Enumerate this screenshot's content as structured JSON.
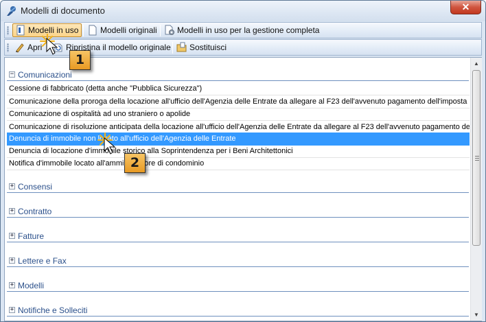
{
  "window": {
    "title": "Modelli di documento",
    "close_glyph": "✕"
  },
  "toolbar1": {
    "buttons": [
      {
        "label": "Modelli in uso",
        "icon": "document-in-use-icon",
        "active": true
      },
      {
        "label": "Modelli originali",
        "icon": "document-icon",
        "active": false
      },
      {
        "label": "Modelli in uso per la gestione completa",
        "icon": "document-gear-icon",
        "active": false
      }
    ]
  },
  "toolbar2": {
    "buttons": [
      {
        "label": "Apri",
        "icon": "pencil-icon"
      },
      {
        "label": "Ripristina il modello originale",
        "icon": "restore-icon"
      },
      {
        "label": "Sostituisci",
        "icon": "folder-icon"
      }
    ]
  },
  "groups": [
    {
      "name": "Comunicazioni",
      "expander": "−",
      "expanded": true,
      "items": [
        "Cessione di fabbricato (detta anche \"Pubblica Sicurezza\")",
        "Comunicazione della proroga della locazione all'ufficio dell'Agenzia delle Entrate da allegare al F23 dell'avvenuto pagamento dell'imposta di re",
        "Comunicazione di ospitalità ad uno straniero o apolide",
        "Comunicazione di risoluzione anticipata della locazione all'ufficio dell'Agenzia delle Entrate da allegare al F23 dell'avvenuto pagamento dell'imp",
        "Denuncia di immobile non locato all'ufficio dell'Agenzia delle Entrate",
        "Denuncia di locazione d'immobile storico alla Soprintendenza per i Beni Architettonici",
        "Notifica d'immobile locato all'amministratore di condominio"
      ],
      "selected_index": 4
    },
    {
      "name": "Consensi",
      "expander": "+",
      "expanded": false
    },
    {
      "name": "Contratto",
      "expander": "+",
      "expanded": false
    },
    {
      "name": "Fatture",
      "expander": "+",
      "expanded": false
    },
    {
      "name": "Lettere e Fax",
      "expander": "+",
      "expanded": false
    },
    {
      "name": "Modelli",
      "expander": "+",
      "expanded": false
    },
    {
      "name": "Notifiche e Solleciti",
      "expander": "+",
      "expanded": false
    }
  ],
  "callouts": {
    "step1": "1",
    "step2": "2"
  },
  "colors": {
    "selection": "#3399ff",
    "group_text": "#2a4f8a",
    "callout": "#f0ad3c"
  }
}
